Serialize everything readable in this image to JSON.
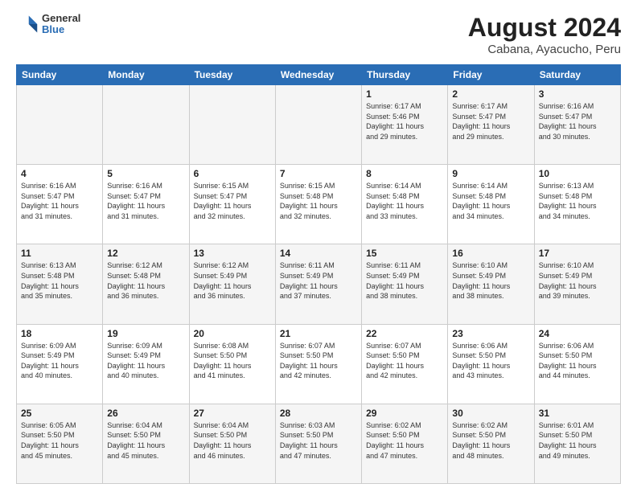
{
  "header": {
    "logo_general": "General",
    "logo_blue": "Blue",
    "title": "August 2024",
    "subtitle": "Cabana, Ayacucho, Peru"
  },
  "weekdays": [
    "Sunday",
    "Monday",
    "Tuesday",
    "Wednesday",
    "Thursday",
    "Friday",
    "Saturday"
  ],
  "weeks": [
    [
      {
        "day": "",
        "info": ""
      },
      {
        "day": "",
        "info": ""
      },
      {
        "day": "",
        "info": ""
      },
      {
        "day": "",
        "info": ""
      },
      {
        "day": "1",
        "info": "Sunrise: 6:17 AM\nSunset: 5:46 PM\nDaylight: 11 hours\nand 29 minutes."
      },
      {
        "day": "2",
        "info": "Sunrise: 6:17 AM\nSunset: 5:47 PM\nDaylight: 11 hours\nand 29 minutes."
      },
      {
        "day": "3",
        "info": "Sunrise: 6:16 AM\nSunset: 5:47 PM\nDaylight: 11 hours\nand 30 minutes."
      }
    ],
    [
      {
        "day": "4",
        "info": "Sunrise: 6:16 AM\nSunset: 5:47 PM\nDaylight: 11 hours\nand 31 minutes."
      },
      {
        "day": "5",
        "info": "Sunrise: 6:16 AM\nSunset: 5:47 PM\nDaylight: 11 hours\nand 31 minutes."
      },
      {
        "day": "6",
        "info": "Sunrise: 6:15 AM\nSunset: 5:47 PM\nDaylight: 11 hours\nand 32 minutes."
      },
      {
        "day": "7",
        "info": "Sunrise: 6:15 AM\nSunset: 5:48 PM\nDaylight: 11 hours\nand 32 minutes."
      },
      {
        "day": "8",
        "info": "Sunrise: 6:14 AM\nSunset: 5:48 PM\nDaylight: 11 hours\nand 33 minutes."
      },
      {
        "day": "9",
        "info": "Sunrise: 6:14 AM\nSunset: 5:48 PM\nDaylight: 11 hours\nand 34 minutes."
      },
      {
        "day": "10",
        "info": "Sunrise: 6:13 AM\nSunset: 5:48 PM\nDaylight: 11 hours\nand 34 minutes."
      }
    ],
    [
      {
        "day": "11",
        "info": "Sunrise: 6:13 AM\nSunset: 5:48 PM\nDaylight: 11 hours\nand 35 minutes."
      },
      {
        "day": "12",
        "info": "Sunrise: 6:12 AM\nSunset: 5:48 PM\nDaylight: 11 hours\nand 36 minutes."
      },
      {
        "day": "13",
        "info": "Sunrise: 6:12 AM\nSunset: 5:49 PM\nDaylight: 11 hours\nand 36 minutes."
      },
      {
        "day": "14",
        "info": "Sunrise: 6:11 AM\nSunset: 5:49 PM\nDaylight: 11 hours\nand 37 minutes."
      },
      {
        "day": "15",
        "info": "Sunrise: 6:11 AM\nSunset: 5:49 PM\nDaylight: 11 hours\nand 38 minutes."
      },
      {
        "day": "16",
        "info": "Sunrise: 6:10 AM\nSunset: 5:49 PM\nDaylight: 11 hours\nand 38 minutes."
      },
      {
        "day": "17",
        "info": "Sunrise: 6:10 AM\nSunset: 5:49 PM\nDaylight: 11 hours\nand 39 minutes."
      }
    ],
    [
      {
        "day": "18",
        "info": "Sunrise: 6:09 AM\nSunset: 5:49 PM\nDaylight: 11 hours\nand 40 minutes."
      },
      {
        "day": "19",
        "info": "Sunrise: 6:09 AM\nSunset: 5:49 PM\nDaylight: 11 hours\nand 40 minutes."
      },
      {
        "day": "20",
        "info": "Sunrise: 6:08 AM\nSunset: 5:50 PM\nDaylight: 11 hours\nand 41 minutes."
      },
      {
        "day": "21",
        "info": "Sunrise: 6:07 AM\nSunset: 5:50 PM\nDaylight: 11 hours\nand 42 minutes."
      },
      {
        "day": "22",
        "info": "Sunrise: 6:07 AM\nSunset: 5:50 PM\nDaylight: 11 hours\nand 42 minutes."
      },
      {
        "day": "23",
        "info": "Sunrise: 6:06 AM\nSunset: 5:50 PM\nDaylight: 11 hours\nand 43 minutes."
      },
      {
        "day": "24",
        "info": "Sunrise: 6:06 AM\nSunset: 5:50 PM\nDaylight: 11 hours\nand 44 minutes."
      }
    ],
    [
      {
        "day": "25",
        "info": "Sunrise: 6:05 AM\nSunset: 5:50 PM\nDaylight: 11 hours\nand 45 minutes."
      },
      {
        "day": "26",
        "info": "Sunrise: 6:04 AM\nSunset: 5:50 PM\nDaylight: 11 hours\nand 45 minutes."
      },
      {
        "day": "27",
        "info": "Sunrise: 6:04 AM\nSunset: 5:50 PM\nDaylight: 11 hours\nand 46 minutes."
      },
      {
        "day": "28",
        "info": "Sunrise: 6:03 AM\nSunset: 5:50 PM\nDaylight: 11 hours\nand 47 minutes."
      },
      {
        "day": "29",
        "info": "Sunrise: 6:02 AM\nSunset: 5:50 PM\nDaylight: 11 hours\nand 47 minutes."
      },
      {
        "day": "30",
        "info": "Sunrise: 6:02 AM\nSunset: 5:50 PM\nDaylight: 11 hours\nand 48 minutes."
      },
      {
        "day": "31",
        "info": "Sunrise: 6:01 AM\nSunset: 5:50 PM\nDaylight: 11 hours\nand 49 minutes."
      }
    ]
  ]
}
